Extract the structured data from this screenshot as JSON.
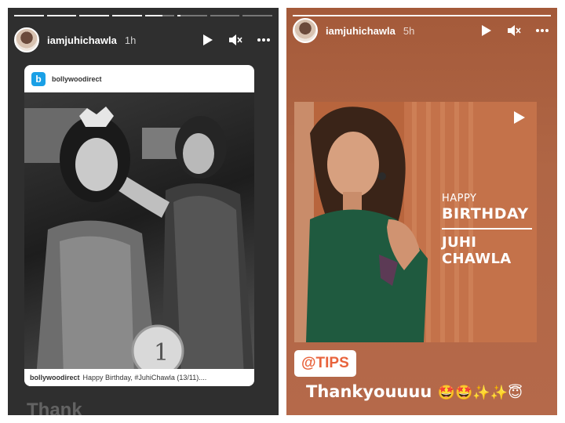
{
  "stories": [
    {
      "username": "iamjuhichawla",
      "time": "1h",
      "progress": [
        1,
        1,
        1,
        1,
        0.6,
        0.1,
        0,
        0
      ],
      "shared_post": {
        "source_name": "bollywoodirect",
        "source_logo_letter": "b",
        "caption_user": "bollywoodirect",
        "caption_text": "Happy Birthday, #JuhiChawla (13/11)...."
      },
      "bottom_text": "Thank                          "
    },
    {
      "username": "iamjuhichawla",
      "time": "5h",
      "progress": [
        1
      ],
      "video": {
        "line1": "HAPPY",
        "line2": "BIRTHDAY",
        "line3": "JUHI CHAWLA"
      },
      "mention": "@TIPS",
      "message": "Thankyouuuu",
      "emojis": "🤩🤩✨✨😇"
    }
  ],
  "colors": {
    "left_bg": "#2f2f2f",
    "right_bg": "#b06645",
    "mention_text": "#e8633c"
  }
}
